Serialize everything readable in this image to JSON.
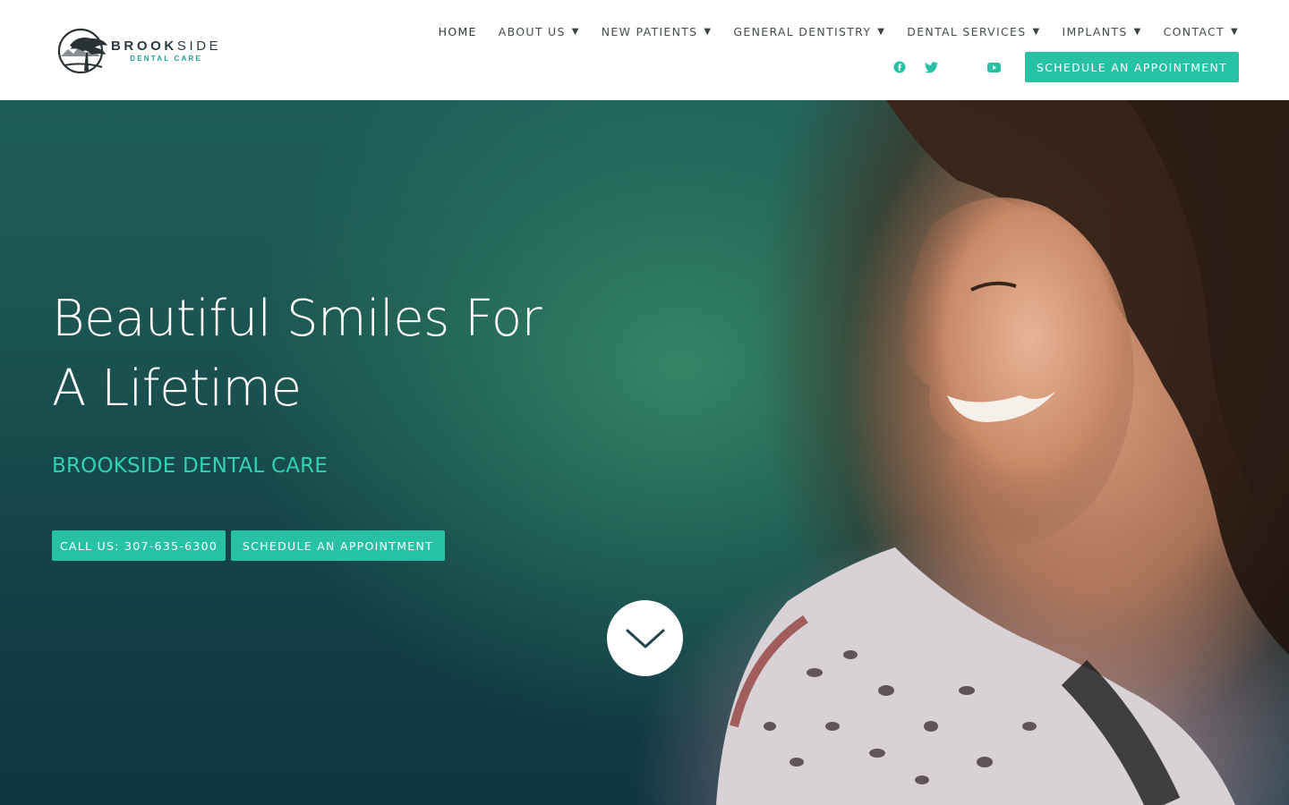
{
  "brand": {
    "name_bold": "BROOK",
    "name_light": "SIDE",
    "subtitle": "DENTAL CARE"
  },
  "nav": {
    "items": [
      {
        "label": "HOME",
        "has_dropdown": false
      },
      {
        "label": "ABOUT US",
        "has_dropdown": true
      },
      {
        "label": "NEW PATIENTS",
        "has_dropdown": true
      },
      {
        "label": "GENERAL DENTISTRY",
        "has_dropdown": true
      },
      {
        "label": "DENTAL SERVICES",
        "has_dropdown": true
      },
      {
        "label": "IMPLANTS",
        "has_dropdown": true
      },
      {
        "label": "CONTACT",
        "has_dropdown": true
      }
    ],
    "caret": "▼"
  },
  "social": {
    "icons": [
      "facebook-icon",
      "twitter-icon",
      "youtube-icon"
    ]
  },
  "header_cta": {
    "label": "SCHEDULE AN APPOINTMENT"
  },
  "hero": {
    "title_line1": "Beautiful Smiles For",
    "title_line2": "A Lifetime",
    "subtitle": "BROOKSIDE DENTAL CARE",
    "call_button": "CALL US: 307-635-6300",
    "schedule_button": "SCHEDULE AN APPOINTMENT",
    "scroll_icon": "chevron-down-icon"
  },
  "colors": {
    "accent": "#27c1a6",
    "accent_text": "#2fd3b2",
    "nav_text": "#434c4e",
    "hero_dark": "#133f47"
  }
}
